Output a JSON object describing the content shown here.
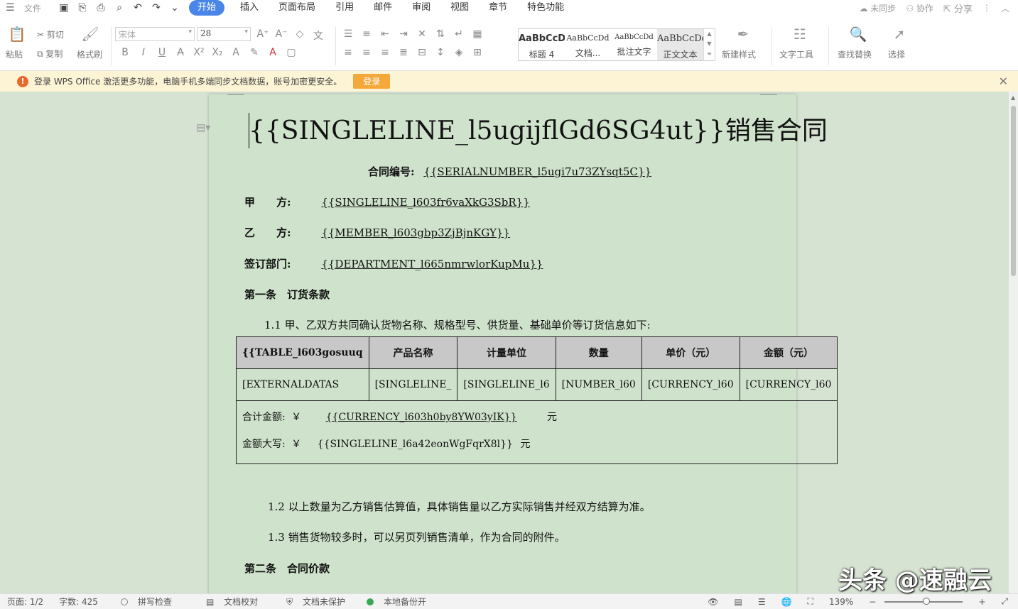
{
  "menubar": {
    "file": "文件",
    "tabs": [
      "开始",
      "插入",
      "页面布局",
      "引用",
      "邮件",
      "审阅",
      "视图",
      "章节",
      "特色功能"
    ],
    "active_tab": "开始",
    "sync": "未同步",
    "collab": "协作",
    "share": "分享"
  },
  "ribbon": {
    "paste": "粘贴",
    "cut": "剪切",
    "copy": "复制",
    "format_painter": "格式刷",
    "font_name": "宋体",
    "font_size": "28",
    "styles": [
      {
        "sample": "AaBbCcDd",
        "name": "标题 4"
      },
      {
        "sample": "AaBbCcDd",
        "name": "文档..."
      },
      {
        "sample": "AaBbCcDd",
        "name": "批注文字"
      },
      {
        "sample": "AaBbCcDd",
        "name": "正文文本"
      }
    ],
    "new_style": "新建样式",
    "text_tools": "文字工具",
    "find_replace": "查找替换",
    "select": "选择"
  },
  "notice": {
    "message": "登录 WPS Office 激活更多功能，电脑手机多端同步文档数据，账号加密更安全。",
    "login": "登录"
  },
  "document": {
    "title": "{{SINGLELINE_l5ugijflGd6SG4ut}}销售合同",
    "contract_no_label": "合同编号:",
    "contract_no_value": "{{SERIALNUMBER_l5ugi7u73ZYsqt5C}}",
    "party_a_label": "甲　　方:",
    "party_a_value": "{{SINGLELINE_l603fr6vaXkG3SbR}}",
    "party_b_label": "乙　　方:",
    "party_b_value": "{{MEMBER_l603gbp3ZjBjnKGY}}",
    "dept_label": "签订部门:",
    "dept_value": "{{DEPARTMENT_l665nmrwlorKupMu}}",
    "article1": "第一条　订货条款",
    "clause_1_1": "1.1 甲、乙双方共同确认货物名称、规格型号、供货量、基础单价等订货信息如下:",
    "table": {
      "headers": [
        "{{TABLE_l603gosuuq",
        "产品名称",
        "计量单位",
        "数量",
        "单价（元）",
        "金额（元）"
      ],
      "row": [
        "[EXTERNALDATAS",
        "[SINGLELINE_",
        "[SINGLELINE_l6",
        "[NUMBER_l60",
        "[CURRENCY_l60",
        "[CURRENCY_l60"
      ],
      "total_label": "合计金额:",
      "total_yen": "￥",
      "total_value": "{{CURRENCY_l603h0by8YW03yIK}}",
      "total_unit": "元",
      "upper_label": "金额大写:",
      "upper_yen": "￥",
      "upper_value": "{{SINGLELINE_l6a42eonWgFqrX8l}}",
      "upper_unit": "元"
    },
    "clause_1_2": "1.2 以上数量为乙方销售估算值，具体销售量以乙方实际销售并经双方结算为准。",
    "clause_1_3": "1.3 销售货物较多时，可以另页列销售清单，作为合同的附件。",
    "article2": "第二条　合同价款"
  },
  "status": {
    "page": "页面: 1/2",
    "words": "字数: 425",
    "spell": "拼写检查",
    "proof": "文档校对",
    "protect": "文档未保护",
    "backup": "本地备份开",
    "zoom": "139%"
  },
  "watermark": "头条 @速融云"
}
